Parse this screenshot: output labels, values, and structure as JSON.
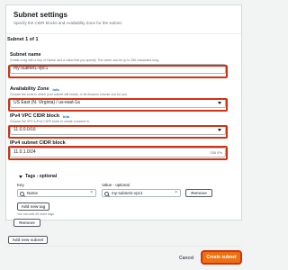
{
  "header": {
    "title": "Subnet settings",
    "description": "Specify the CIDR blocks and Availability Zone for the subnet."
  },
  "subnet": {
    "section_title": "Subnet 1 of 1",
    "name": {
      "label": "Subnet name",
      "description": "Create a tag with a key of 'Name' and a value that you specify. The name can be up to 256 characters long.",
      "value": "my-subnet1-vpc1"
    },
    "az": {
      "label": "Availability Zone",
      "info": "Info",
      "description": "Choose the zone in which your subnet will reside, or let Amazon choose one for you.",
      "value": "US East (N. Virginia) / us-east-1a"
    },
    "vpc_cidr": {
      "label": "IPv4 VPC CIDR block",
      "info": "Info",
      "description": "Choose the VPC's IPv4 CIDR block to create a subnet in.",
      "value": "11.0.0.0/16"
    },
    "subnet_cidr": {
      "label": "IPv4 subnet CIDR block",
      "value": "11.0.1.0/24",
      "hint": "256 IPs"
    }
  },
  "tags": {
    "heading": "Tags - optional",
    "key_label": "Key",
    "value_label": "Value - optional",
    "key_value": "Name",
    "value_value": "my-subnet1-vpc1",
    "remove_label": "Remove",
    "add_tag_label": "Add new tag",
    "limit_note": "You can add 49 more tags.",
    "remove_subnet_label": "Remove"
  },
  "add_subnet_label": "Add new subnet",
  "footer": {
    "cancel_label": "Cancel",
    "create_label": "Create subnet"
  },
  "colors": {
    "accent": "#ec7211",
    "highlight": "#d13212",
    "link": "#0073bb"
  }
}
